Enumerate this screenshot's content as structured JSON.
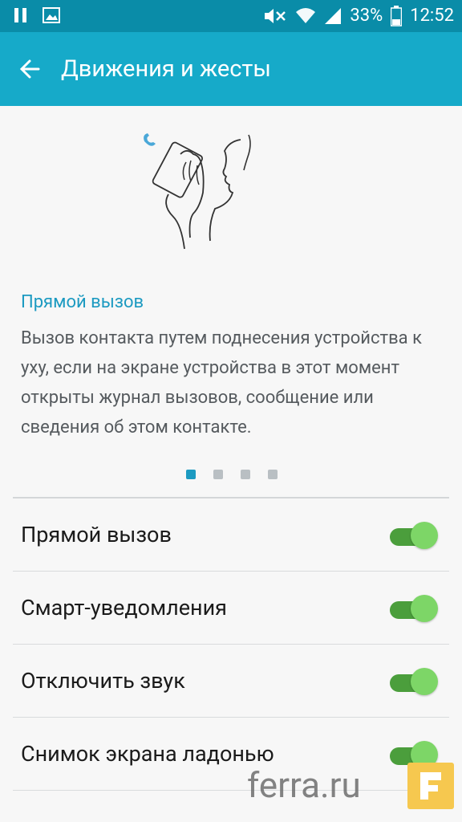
{
  "status_bar": {
    "battery": "33%",
    "time": "12:52"
  },
  "app_bar": {
    "title": "Движения и жесты"
  },
  "tutorial": {
    "title": "Прямой вызов",
    "description": "Вызов контакта путем поднесения устройства к уху, если на экране устройства в этот момент открыты журнал вызовов, сообщение или сведения об этом контакте.",
    "pages": 4,
    "active_page": 1
  },
  "settings": [
    {
      "label": "Прямой вызов",
      "enabled": true
    },
    {
      "label": "Смарт-уведомления",
      "enabled": true
    },
    {
      "label": "Отключить звук",
      "enabled": true
    },
    {
      "label": "Снимок экрана ладонью",
      "enabled": true
    }
  ],
  "watermark": {
    "text": "ferra.ru"
  },
  "colors": {
    "status_bar": "#0a8ca8",
    "app_bar": "#16aac9",
    "accent": "#1c9ac1",
    "toggle_on": "#7dd667"
  }
}
